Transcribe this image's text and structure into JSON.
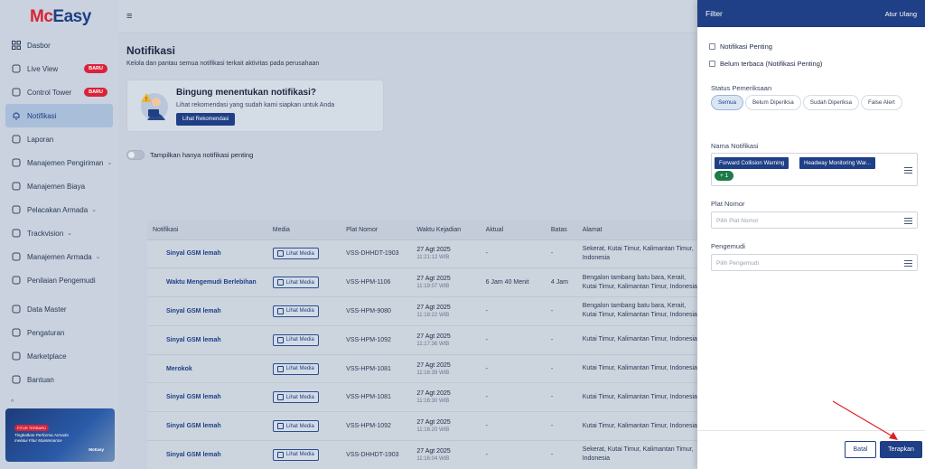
{
  "brand": {
    "part1": "Mc",
    "part2": "Easy"
  },
  "sidebar": {
    "items": [
      {
        "label": "Dasbor",
        "icon": "grid-icon"
      },
      {
        "label": "Live View",
        "icon": "eye-icon",
        "badge": "BARU"
      },
      {
        "label": "Control Tower",
        "icon": "pulse-icon",
        "badge": "BARU"
      },
      {
        "label": "Notifikasi",
        "icon": "bell-icon",
        "active": true
      },
      {
        "label": "Laporan",
        "icon": "report-icon"
      },
      {
        "label": "Manajemen Pengiriman",
        "icon": "truck-icon",
        "chevron": true
      },
      {
        "label": "Manajemen Biaya",
        "icon": "coin-icon"
      },
      {
        "label": "Pelacakan Armada",
        "icon": "route-icon",
        "chevron": true
      },
      {
        "label": "Trackvision",
        "icon": "camera-icon",
        "chevron": true
      },
      {
        "label": "Manajemen Armada",
        "icon": "fleet-icon",
        "chevron": true
      },
      {
        "label": "Penilaian Pengemudi",
        "icon": "driver-icon"
      },
      {
        "label": "Data Master",
        "icon": "database-icon"
      },
      {
        "label": "Pengaturan",
        "icon": "gear-icon"
      },
      {
        "label": "Marketplace",
        "icon": "store-icon"
      },
      {
        "label": "Bantuan",
        "icon": "help-icon"
      }
    ],
    "promo": {
      "tag": "FITUR TERBARU",
      "text": "Tingkatkan Performa Armada melalui Fitur Maintenance",
      "brand": "McEasy"
    }
  },
  "main": {
    "title": "Notifikasi",
    "subtitle": "Kelola dan pantau semua notifikasi terkait aktivitas pada perusahaan",
    "reco": {
      "heading": "Bingung menentukan notifikasi?",
      "text": "Lihat rekomendasi yang sudah kami siapkan untuk Anda",
      "button": "Lihat Rekomendasi"
    },
    "toggle_label": "Tampilkan hanya notifikasi penting",
    "table": {
      "headers": [
        "Notifikasi",
        "Media",
        "Plat Nomor",
        "Waktu Kejadian",
        "Aktual",
        "Batas",
        "Alamat"
      ],
      "media_label": "Lihat Media",
      "rows": [
        {
          "name": "Sinyal GSM lemah",
          "plate": "VSS-DHHDT-1903",
          "date": "27 Agt 2025",
          "time": "11:21:12 WIB",
          "actual": "-",
          "limit": "-",
          "address": [
            "Sekerat, Kutai Timur, Kalimantan Timur,",
            "Indonesia"
          ]
        },
        {
          "name": "Waktu Mengemudi Berlebihan",
          "plate": "VSS-HPM-1106",
          "date": "27 Agt 2025",
          "time": "11:19:07 WIB",
          "actual": "6 Jam 40 Menit",
          "limit": "4 Jam",
          "address": [
            "Bengalon tambang batu bara, Kerait,",
            "Kutai Timur, Kalimantan Timur, Indonesia"
          ]
        },
        {
          "name": "Sinyal GSM lemah",
          "plate": "VSS-HPM-9080",
          "date": "27 Agt 2025",
          "time": "11:18:22 WIB",
          "actual": "-",
          "limit": "-",
          "address": [
            "Bengalon tambang batu bara, Kerait,",
            "Kutai Timur, Kalimantan Timur, Indonesia"
          ]
        },
        {
          "name": "Sinyal GSM lemah",
          "plate": "VSS-HPM-1092",
          "date": "27 Agt 2025",
          "time": "11:17:36 WIB",
          "actual": "-",
          "limit": "-",
          "address": [
            "Kutai Timur, Kalimantan Timur, Indonesia"
          ]
        },
        {
          "name": "Merokok",
          "plate": "VSS-HPM-1081",
          "date": "27 Agt 2025",
          "time": "11:16:39 WIB",
          "actual": "-",
          "limit": "-",
          "address": [
            "Kutai Timur, Kalimantan Timur, Indonesia"
          ]
        },
        {
          "name": "Sinyal GSM lemah",
          "plate": "VSS-HPM-1081",
          "date": "27 Agt 2025",
          "time": "11:16:30 WIB",
          "actual": "-",
          "limit": "-",
          "address": [
            "Kutai Timur, Kalimantan Timur, Indonesia"
          ]
        },
        {
          "name": "Sinyal GSM lemah",
          "plate": "VSS-HPM-1092",
          "date": "27 Agt 2025",
          "time": "11:16:20 WIB",
          "actual": "-",
          "limit": "-",
          "address": [
            "Kutai Timur, Kalimantan Timur, Indonesia"
          ]
        },
        {
          "name": "Sinyal GSM lemah",
          "plate": "VSS-DHHDT-1903",
          "date": "27 Agt 2025",
          "time": "11:16:04 WIB",
          "actual": "-",
          "limit": "-",
          "address": [
            "Sekerat, Kutai Timur, Kalimantan Timur,",
            "Indonesia"
          ]
        }
      ]
    }
  },
  "filter": {
    "title": "Filter",
    "reset": "Atur Ulang",
    "checks": [
      "Notifikasi Penting",
      "Belum terbaca (Notifikasi Penting)"
    ],
    "status_label": "Status Pemeriksaan",
    "status_options": [
      "Semua",
      "Belum Diperiksa",
      "Sudah Diperiksa",
      "False Alert"
    ],
    "status_selected": "Semua",
    "name_label": "Nama Notifikasi",
    "name_tags": [
      "Forward Collision Warning",
      "Headway Monitoring War..."
    ],
    "name_more": "+ 1",
    "plate_label": "Plat Nomor",
    "plate_placeholder": "Pilih Plat Nomor",
    "driver_label": "Pengemudi",
    "driver_placeholder": "Pilih Pengemudi",
    "cancel": "Batal",
    "apply": "Terapkan"
  },
  "colors": {
    "primary": "#1f3f86",
    "brand_red": "#d9233a",
    "success": "#1f7a4a",
    "arrow": "#e02020"
  }
}
